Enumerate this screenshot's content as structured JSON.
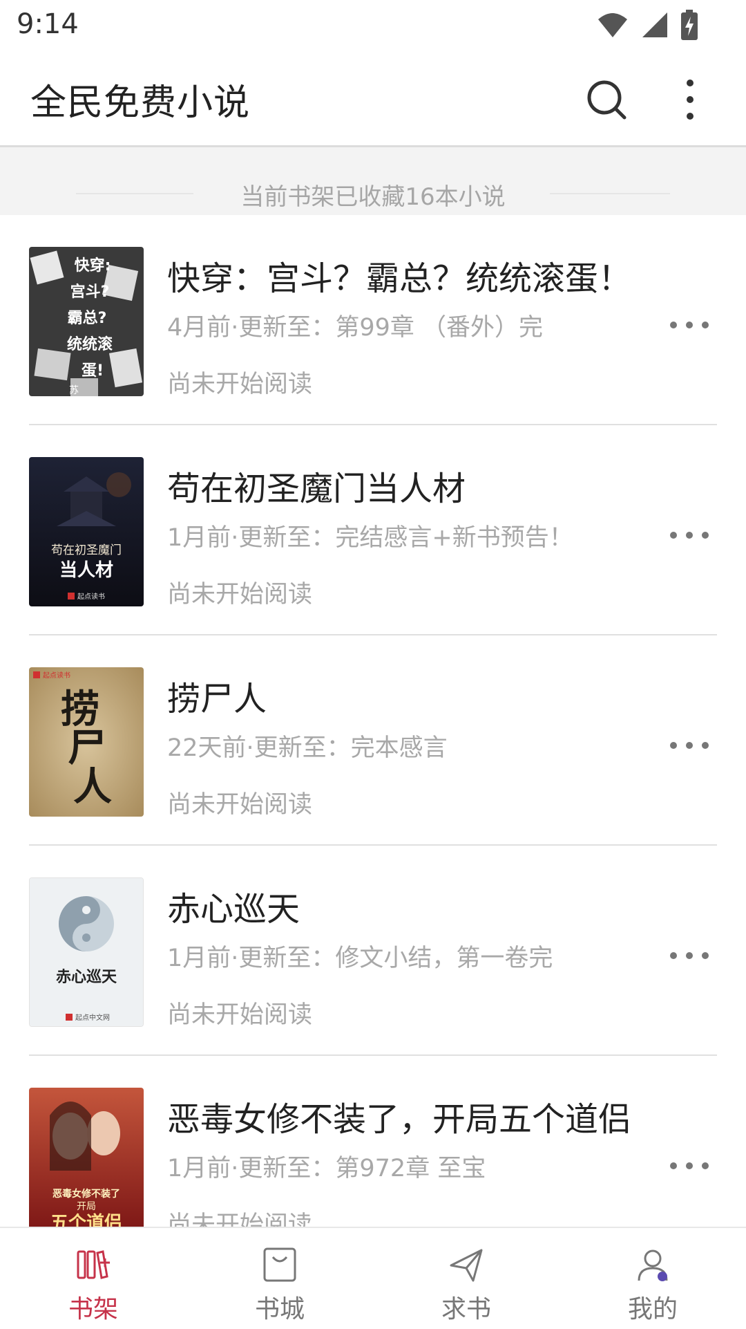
{
  "status_bar": {
    "time": "9:14"
  },
  "app_bar": {
    "title": "全民免费小说"
  },
  "shelf_banner": {
    "text": "当前书架已收藏16本小说"
  },
  "books": [
    {
      "title": "快穿：宫斗？霸总？统统滚蛋！",
      "update": "4月前·更新至：第99章 （番外）完",
      "progress": "尚未开始阅读",
      "cover_text": [
        "快穿:",
        "宫斗?",
        "霸总?",
        "统统滚",
        "蛋!"
      ],
      "cover_author": "苏"
    },
    {
      "title": "苟在初圣魔门当人材",
      "update": "1月前·更新至：完结感言+新书预告！",
      "progress": "尚未开始阅读",
      "cover_text": [
        "苟在初圣魔门",
        "当人材"
      ],
      "cover_publisher": "起点读书"
    },
    {
      "title": "捞尸人",
      "update": "22天前·更新至：完本感言",
      "progress": "尚未开始阅读",
      "cover_text": [
        "捞",
        "尸",
        "人"
      ],
      "cover_publisher": "起点读书"
    },
    {
      "title": "赤心巡天",
      "update": "1月前·更新至：修文小结，第一卷完",
      "progress": "尚未开始阅读",
      "cover_text": [
        "赤心巡天"
      ],
      "cover_publisher": "起点中文网"
    },
    {
      "title": "恶毒女修不装了，开局五个道侣",
      "update": "1月前·更新至：第972章 至宝",
      "progress": "尚未开始阅读",
      "cover_text": [
        "恶毒女修不装了",
        "开局",
        "五个道侣"
      ]
    }
  ],
  "bottom_nav": [
    {
      "label": "书架",
      "icon": "bookshelf-icon",
      "active": true
    },
    {
      "label": "书城",
      "icon": "bookstore-bag-icon",
      "active": false
    },
    {
      "label": "求书",
      "icon": "paper-plane-icon",
      "active": false
    },
    {
      "label": "我的",
      "icon": "user-profile-icon",
      "active": false
    }
  ],
  "colors": {
    "accent": "#c6334a",
    "secondary_text": "#a8a8a8",
    "primary_text": "#222222"
  }
}
